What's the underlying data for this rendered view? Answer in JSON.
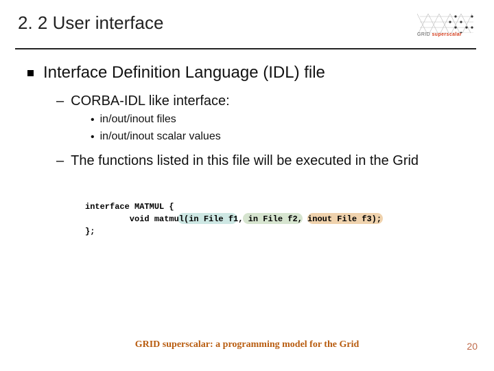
{
  "header": {
    "title": "2. 2 User interface",
    "logo_grid": "GRID",
    "logo_ss": "superscalar"
  },
  "bullets": {
    "l1": "Interface Definition Language (IDL) file",
    "l2a": "CORBA-IDL like interface:",
    "l3a": "in/out/inout files",
    "l3b": "in/out/inout scalar values",
    "l2b": "The functions listed in this file will be executed in the Grid"
  },
  "code": {
    "line1": "interface MATMUL {",
    "line2": "         void matmul(in File f1, in File f2, inout File f3);",
    "line3": "};"
  },
  "footer": {
    "text": "GRID superscalar: a programming model for the Grid",
    "page": "20"
  }
}
